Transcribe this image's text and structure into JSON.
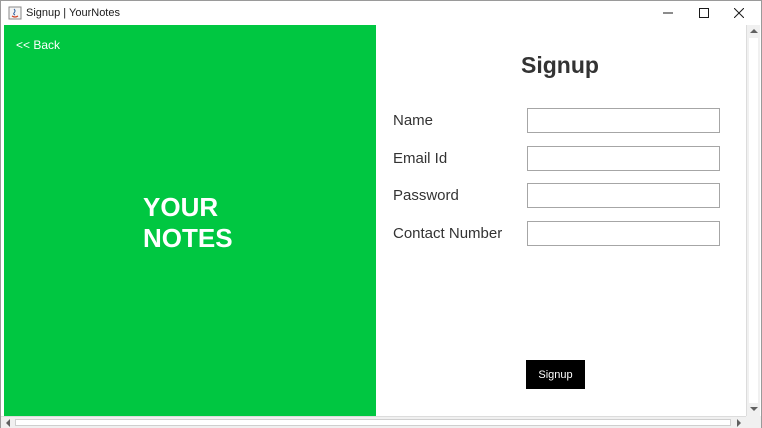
{
  "window": {
    "title": "Signup | YourNotes",
    "controls": [
      "minimize-icon",
      "maximize-icon",
      "close-icon"
    ]
  },
  "left_panel": {
    "back_label": "<< Back",
    "brand_line1": "YOUR",
    "brand_line2": "NOTES",
    "background_color": "#00c741"
  },
  "form": {
    "title": "Signup",
    "fields": [
      {
        "label": "Name",
        "value": ""
      },
      {
        "label": "Email Id",
        "value": ""
      },
      {
        "label": "Password",
        "value": ""
      },
      {
        "label": "Contact Number",
        "value": ""
      }
    ],
    "submit_label": "Signup",
    "submit_color": "#000000"
  }
}
